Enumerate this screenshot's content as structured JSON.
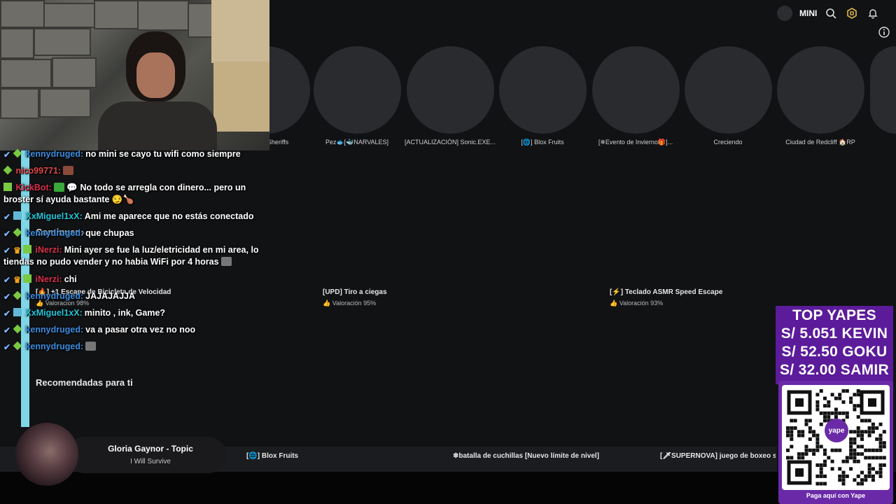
{
  "topbar": {
    "user_name": "MINI",
    "icons": [
      "search-icon",
      "robux-icon",
      "bell-icon"
    ],
    "info_icon": "info-icon"
  },
  "experiences": [
    {
      "label": "...os VS Sheriffs"
    },
    {
      "label": "Pez🐟[🐳NARVALES]"
    },
    {
      "label": "[ACTUALIZACIÓN] Sonic.EXE..."
    },
    {
      "label": "[🌐] Blox Fruits"
    },
    {
      "label": "[❄Evento de Invierno🎁]..."
    },
    {
      "label": "Creciendo"
    },
    {
      "label": "Ciudad de Redcliff 🏠RP"
    }
  ],
  "continue": {
    "label": "Continuar",
    "chevron": "›"
  },
  "game_cards": [
    {
      "title": "[🔥] +1 Escape de Bicicleta de Velocidad",
      "rating": "Valoración 98%"
    },
    {
      "title": "[UPD] Tiro a ciegas",
      "rating": "Valoración 95%"
    },
    {
      "title": "[⚡] Teclado ASMR Speed Escape",
      "rating": "Valoración 93%"
    }
  ],
  "section_title": "Recomendadas para ti",
  "recommended": [
    {
      "label": "[🌐] Blox Fruits"
    },
    {
      "label": "❄batalla de cuchillas [Nuevo límite de nivel]"
    },
    {
      "label": "[🗡SUPERNOVA] juego de boxeo sin tí"
    }
  ],
  "now_playing": {
    "title": "Gloria Gaynor - Topic",
    "subtitle": "I Will Survive"
  },
  "chat": [
    {
      "user": "kennydruged:",
      "user_color": "#3a8ddf",
      "text": "no mini se cayo tu wifi como siempre"
    },
    {
      "user": "nico99771:",
      "user_color": "#e04848",
      "text": ""
    },
    {
      "user": "KickBot:",
      "user_color": "#d9304a",
      "text": "No todo se arregla con dinero... pero un broster sí ayuda bastante 😏🍗"
    },
    {
      "user": "XxMiguel1xX:",
      "user_color": "#21c5d8",
      "text": "Ami me aparece que no estás conectado"
    },
    {
      "user": "kennydruged:",
      "user_color": "#3a8ddf",
      "text": "que chupas"
    },
    {
      "user": "iNerzi:",
      "user_color": "#d9304a",
      "text": "Mini ayer se fue la luz/eletricidad en mi area, lo tiendas no pudo vender y no habia WiFi por 4 horas"
    },
    {
      "user": "iNerzi:",
      "user_color": "#d9304a",
      "text": "chi"
    },
    {
      "user": "kennydruged:",
      "user_color": "#3a8ddf",
      "text": "JAJAJAJJA"
    },
    {
      "user": "XxMiguel1xX:",
      "user_color": "#21c5d8",
      "text": "minito , ink, Game?"
    },
    {
      "user": "kennydruged:",
      "user_color": "#3a8ddf",
      "text": "va a pasar otra vez no noo"
    },
    {
      "user": "kennydruged:",
      "user_color": "#3a8ddf",
      "text": ""
    }
  ],
  "yape": {
    "header": "TOP YAPES",
    "donors": [
      "S/ 5.051 KEVIN",
      "S/ 52.50 GOKU",
      "S/ 32.00 SAMIR"
    ],
    "logo_text": "yape",
    "caption": "Paga aquí con Yape"
  },
  "colors": {
    "background": "#111214",
    "yape_purple": "#5b1b9a",
    "chat_rail": "#7fd6e6"
  }
}
